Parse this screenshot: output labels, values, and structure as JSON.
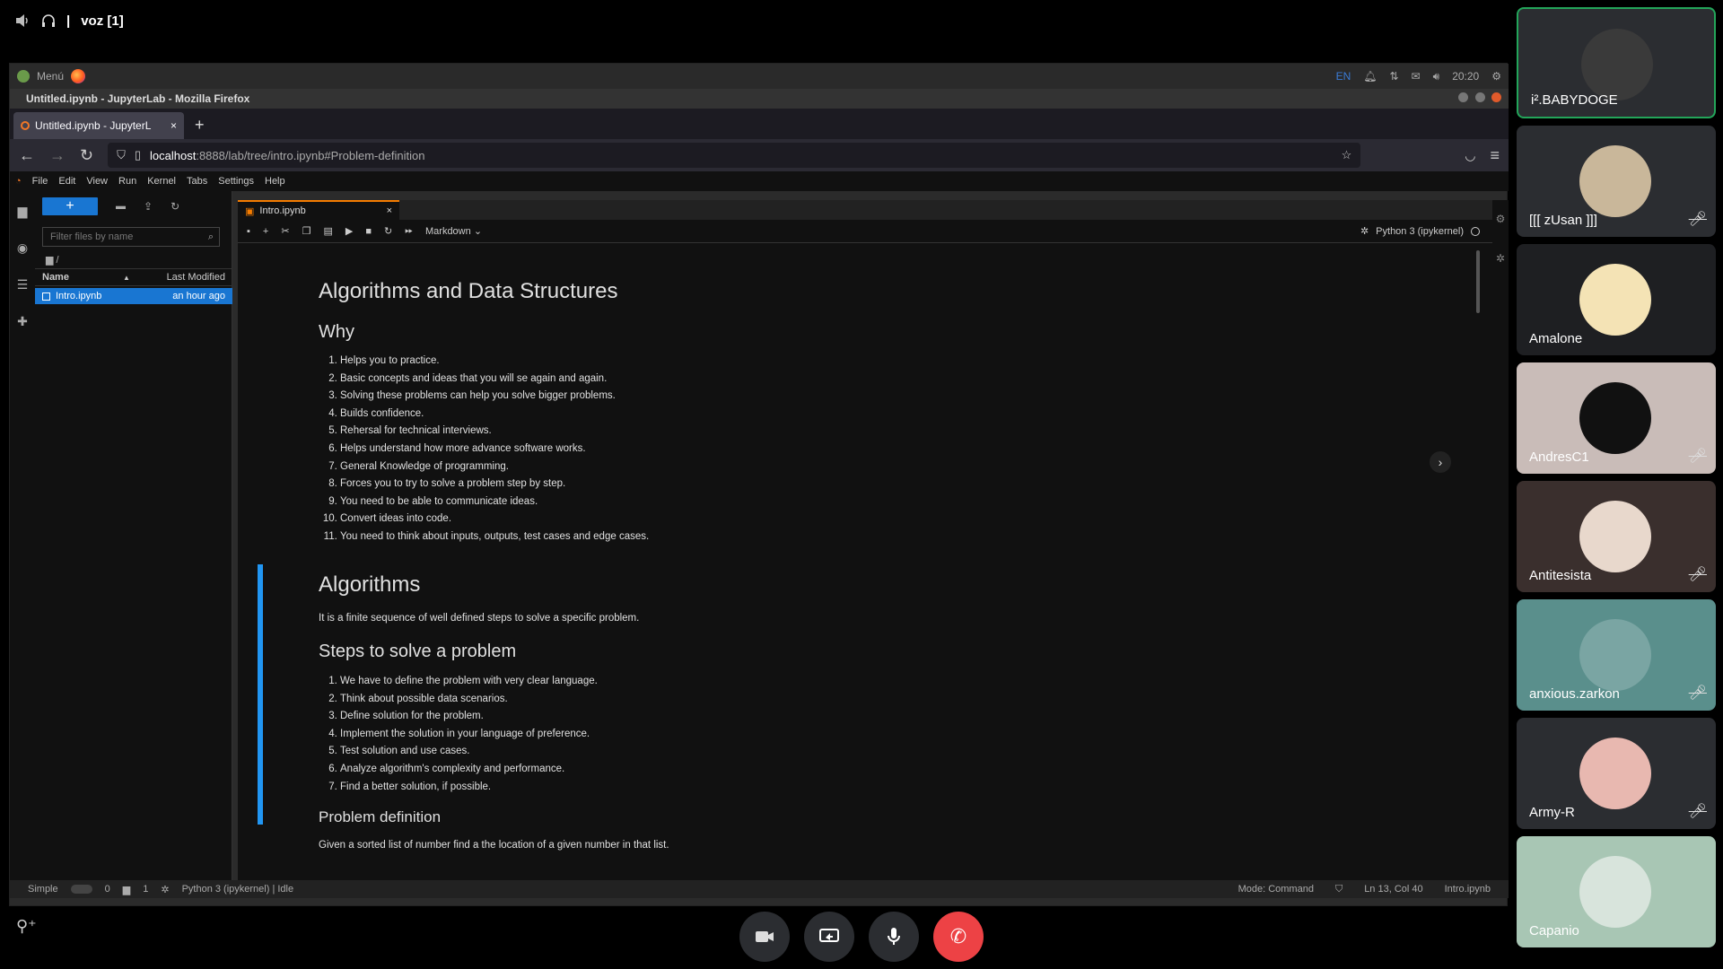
{
  "voice": {
    "channel": "voz [1]"
  },
  "os": {
    "menu": "Menú",
    "time": "20:20",
    "lang": "EN"
  },
  "window": {
    "title": "Untitled.ipynb - JupyterLab - Mozilla Firefox"
  },
  "browser": {
    "tab_title": "Untitled.ipynb - JupyterL",
    "url_host": "localhost",
    "url_rest": ":8888/lab/tree/intro.ipynb#Problem-definition"
  },
  "jupyter": {
    "menu": [
      "File",
      "Edit",
      "View",
      "Run",
      "Kernel",
      "Tabs",
      "Settings",
      "Help"
    ],
    "filter_placeholder": "Filter files by name",
    "crumb": "/",
    "col_name": "Name",
    "col_modified": "Last Modified",
    "file": {
      "name": "Intro.ipynb",
      "modified": "an hour ago"
    },
    "doc_tab": "Intro.ipynb",
    "cell_type": "Markdown",
    "kernel": "Python 3 (ipykernel)",
    "status": {
      "mode_label": "Simple",
      "counts_a": "0",
      "counts_b": "1",
      "kernel_status": "Python 3 (ipykernel) | Idle",
      "mode": "Mode: Command",
      "position": "Ln 13, Col 40",
      "file": "Intro.ipynb"
    }
  },
  "notebook": {
    "title": "Algorithms and Data Structures",
    "why_heading": "Why",
    "why_items": [
      "Helps you to practice.",
      "Basic concepts and ideas that you will se again and again.",
      "Solving these problems can help you solve bigger problems.",
      "Builds confidence.",
      "Rehersal for technical interviews.",
      "Helps understand how more advance software works.",
      "General Knowledge of programming.",
      "Forces you to try to solve a problem step by step.",
      "You need to be able to communicate ideas.",
      "Convert ideas into code.",
      "You need to think about inputs, outputs, test cases and edge cases."
    ],
    "algorithms_heading": "Algorithms",
    "algorithms_text": "It is a finite sequence of well defined steps to solve a specific problem.",
    "steps_heading": "Steps to solve a problem",
    "steps_items": [
      "We have to define the problem with very clear language.",
      "Think about possible data scenarios.",
      "Define solution for the problem.",
      "Implement the solution in your language of preference.",
      "Test solution and use cases.",
      "Analyze algorithm's complexity and performance.",
      "Find a better solution, if possible."
    ],
    "problem_heading": "Problem definition",
    "problem_text": "Given a sorted list of number find a the location of a given number in that list."
  },
  "participants": [
    {
      "name": "i².BABYDOGE",
      "color": "#2b2d31",
      "avatar": "#3a3a3a",
      "muted": false,
      "speaking": true
    },
    {
      "name": "[[[ zUsan ]]]",
      "color": "#2b2d31",
      "avatar": "#c9b79a",
      "muted": true
    },
    {
      "name": "Amalone",
      "color": "#1e1f22",
      "avatar": "#f4e3b5",
      "muted": false
    },
    {
      "name": "AndresC1",
      "color": "#c9bcb8",
      "avatar": "#111111",
      "muted": true
    },
    {
      "name": "Antitesista",
      "color": "#3a2f2d",
      "avatar": "#e8d8cc",
      "muted": true
    },
    {
      "name": "anxious.zarkon",
      "color": "#5a8f8c",
      "avatar": "#7aa5a3",
      "muted": true
    },
    {
      "name": "Army-R",
      "color": "#2b2d31",
      "avatar": "#e8b8b0",
      "muted": true
    },
    {
      "name": "Capanio",
      "color": "#a8c6b4",
      "avatar": "#d8e4dc",
      "muted": false
    }
  ],
  "colors": {
    "accent": "#1976d2",
    "cell_selected": "#2196f3",
    "hangup": "#ed4245",
    "speaking": "#23a55a"
  }
}
